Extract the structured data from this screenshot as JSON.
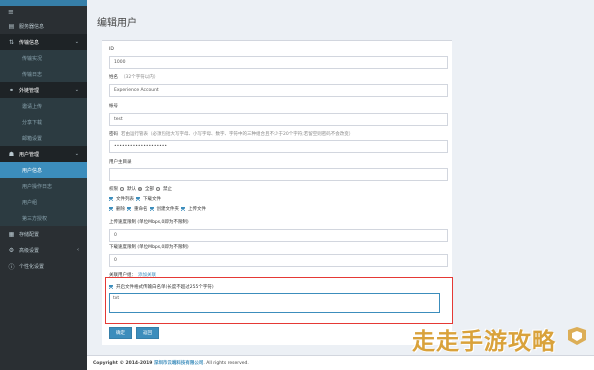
{
  "sidebar": {
    "menu_icon": "hamburger-icon",
    "items": [
      {
        "label": "服务器信息",
        "icon": "server-icon",
        "type": "top"
      },
      {
        "label": "传输信息",
        "icon": "transfer-icon",
        "type": "parent"
      },
      {
        "label": "传输实况",
        "type": "sub"
      },
      {
        "label": "传输日志",
        "type": "sub"
      },
      {
        "label": "外链管理",
        "icon": "link-icon",
        "type": "parent"
      },
      {
        "label": "邀请上传",
        "type": "sub"
      },
      {
        "label": "分享下载",
        "type": "sub"
      },
      {
        "label": "邮箱设置",
        "type": "sub"
      },
      {
        "label": "用户管理",
        "icon": "users-icon",
        "type": "parent"
      },
      {
        "label": "用户信息",
        "type": "sub-active"
      },
      {
        "label": "用户操作日志",
        "type": "sub"
      },
      {
        "label": "用户组",
        "type": "sub"
      },
      {
        "label": "第三方授权",
        "type": "sub"
      },
      {
        "label": "存储配置",
        "icon": "storage-icon",
        "type": "top"
      },
      {
        "label": "高级设置",
        "icon": "gear-icon",
        "type": "top-chev"
      },
      {
        "label": "个性化设置",
        "icon": "info-icon",
        "type": "top"
      }
    ]
  },
  "page": {
    "title": "编辑用户"
  },
  "form": {
    "id_label": "ID",
    "id_value": "1000",
    "name_label": "姓名",
    "name_hint": "（32个字符以内）",
    "name_value": "Experience Account",
    "account_label": "帐号",
    "account_value": "test",
    "password_label": "密码",
    "password_hint": "若由运行管表（必须包括大写字母、小写字母、数字、字符中的三种组合且不少于20个字符;若留空则密码不会改变）",
    "password_value": "••••••••••••••••••••",
    "home_label": "用户主目录",
    "home_value": "",
    "perm_label": "权限",
    "perm_options": [
      "默认",
      "全部",
      "禁止"
    ],
    "perm_row1": [
      "文件列表",
      "下载文件"
    ],
    "perm_row2": [
      "删除",
      "重命名",
      "创建文件夹",
      "上传文件"
    ],
    "upload_limit_label": "上传速度限制 (单位Mbps,0即为不限制)",
    "upload_limit_value": "0",
    "download_limit_label": "下载速度限制 (单位Mbps,0即为不限制)",
    "download_limit_value": "0",
    "group_label": "关联用户组：",
    "group_link": "添加关联",
    "whitelist_label": "开启文件格式传输白名单(长度不超过255个字符)",
    "whitelist_value": "txt",
    "confirm_button": "确定",
    "back_button": "返回"
  },
  "footer": {
    "copyright_prefix": "Copyright © 2014-2019",
    "company": "深圳市云端科技有限公司",
    "suffix": ". All rights reserved."
  },
  "watermark": {
    "text": "走走手游攻略",
    "color": "#d9a23b"
  },
  "colors": {
    "accent": "#3c8dbc",
    "sidebar": "#2a2f33",
    "highlight": "#e53935"
  }
}
